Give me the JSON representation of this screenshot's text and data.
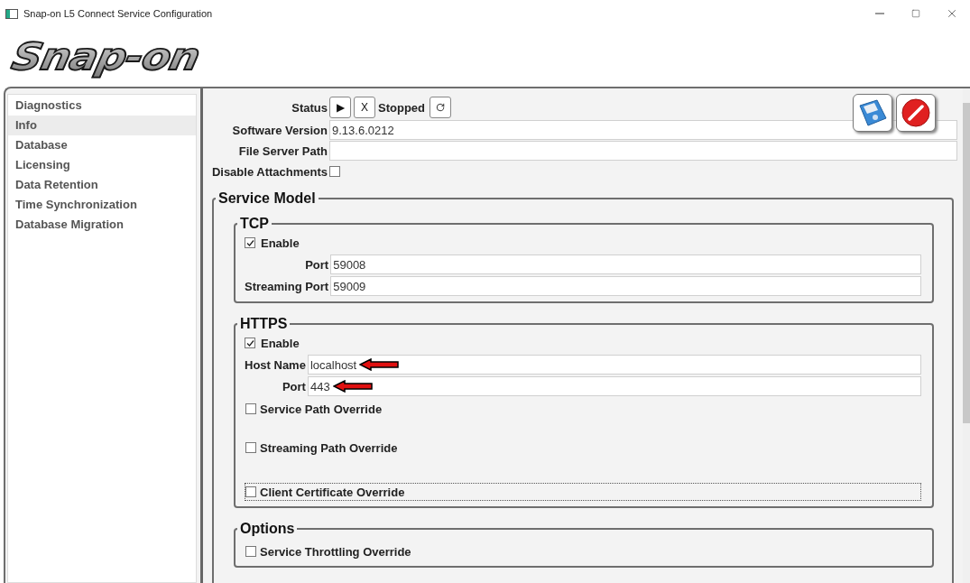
{
  "window": {
    "title": "Snap-on L5 Connect Service Configuration"
  },
  "logo": "Snap-on",
  "sidebar": {
    "items": [
      {
        "label": "Diagnostics",
        "selected": false
      },
      {
        "label": "Info",
        "selected": true
      },
      {
        "label": "Database",
        "selected": false
      },
      {
        "label": "Licensing",
        "selected": false
      },
      {
        "label": "Data Retention",
        "selected": false
      },
      {
        "label": "Time Synchronization",
        "selected": false
      },
      {
        "label": "Database Migration",
        "selected": false
      }
    ]
  },
  "status": {
    "label": "Status",
    "start": "▶",
    "stop": "X",
    "state": "Stopped"
  },
  "fields": [
    {
      "label": "Software Version",
      "value": "9.13.6.0212"
    },
    {
      "label": "File Server Path"
    }
  ],
  "disable_attachments": {
    "label": "Disable Attachments",
    "checked": false
  },
  "service_model": {
    "title": "Service Model",
    "groups": [
      {
        "title": "TCP",
        "enable": {
          "label": "Enable",
          "checked": true
        },
        "fields": [
          {
            "label": "Port",
            "value": "59008",
            "marked": false
          },
          {
            "label": "Streaming Port",
            "value": "59009",
            "marked": false
          }
        ]
      },
      {
        "title": "HTTPS",
        "enable": {
          "label": "Enable",
          "checked": true
        },
        "fields": [
          {
            "label": "Host Name",
            "value": "localhost",
            "marked": true
          },
          {
            "label": "Port",
            "value": "443",
            "marked": true
          }
        ],
        "options": [
          {
            "label": "Service Path Override",
            "checked": false,
            "focused": false
          },
          {
            "label": "Streaming Path Override",
            "checked": false,
            "focused": false
          },
          {
            "label": "Client Certificate Override",
            "checked": false,
            "focused": true
          }
        ]
      },
      {
        "title": "Options",
        "options": [
          {
            "label": "Service Throttling Override",
            "checked": false,
            "focused": false
          }
        ]
      }
    ]
  }
}
